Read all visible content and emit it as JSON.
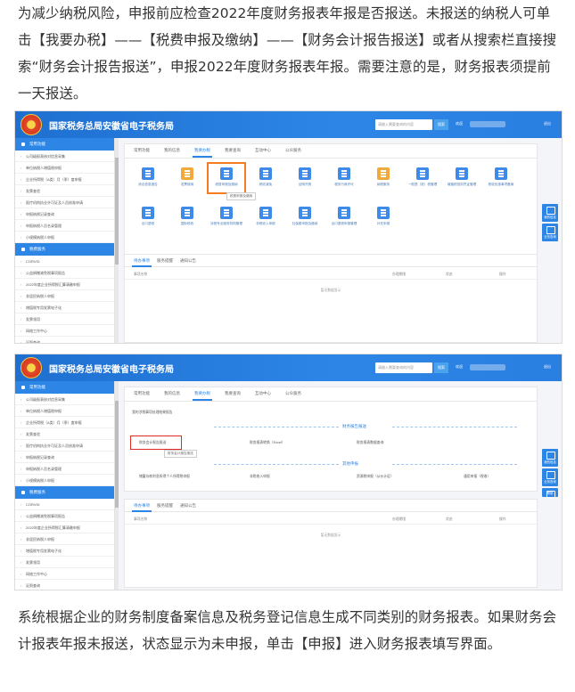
{
  "paragraph_top": "为减少纳税风险，申报前应检查2022年度财务报表年报是否报送。未报送的纳税人可单击【我要办税】——【税费申报及缴纳】——【财务会计报告报送】或者从搜索栏直接搜索“财务会计报告报送”，申报2022年度财务报表年报。需要注意的是，财务报表须提前一天报送。",
  "paragraph_bottom": "系统根据企业的财务制度备案信息及税务登记信息生成不同类别的财务报表。如果财务会计报表年报未报送，状态显示为未申报，单击【申报】进入财务报表填写界面。",
  "site": {
    "title": "国家税务总局安徽省电子税务局",
    "search_placeholder": "请输入需要查询的内容",
    "search_button": "搜索",
    "user_label": "欢迎",
    "logout": "退出"
  },
  "sidebar": {
    "section1": "常用功能",
    "items1": [
      "公司级报表核对信息采集",
      "单位纳税人增值税申报",
      "企业所得税（A类）月（季）度申报",
      "发票查验",
      "医疗机构执业许可证及人员核准申请",
      "申报纳税记录查询",
      "申报纳税人员名录管理",
      "小规模纳税人申报"
    ],
    "section2": "税费服务",
    "items2": [
      "CORVID",
      "公益捐赠减免税事项报告",
      "2022年度企业所得税汇算清缴申报",
      "非居民纳税人申报",
      "增值税专用发票电子化",
      "发票领用",
      "网络工作中心",
      "证照查询"
    ]
  },
  "tabs": [
    "常用功能",
    "我的信息",
    "我要办税",
    "我要查询",
    "互动中心",
    "公众服务"
  ],
  "active_tab_index": 2,
  "icons_row1": [
    "综合信息报告",
    "发票使用",
    "税费申报及缴纳",
    "税收减免",
    "证明开具",
    "税务行政许可",
    "纳税服务",
    "一般退（抵）税管理",
    "增值税抵扣凭证管理",
    "税收优惠事项备案"
  ],
  "icons_row2": [
    "出口退税",
    "国际税收",
    "涉税专业服务机构管理",
    "非税收入申报",
    "社保费申报及缴纳",
    "出口退税申报管理",
    "补充申报"
  ],
  "tooltip": "税费申报及缴纳",
  "lower_tabs": [
    "待办事项",
    "服务提醒",
    "通知公告"
  ],
  "table_headers": [
    "事项名称",
    "办理期限",
    "状态",
    "操作"
  ],
  "empty_text": "暂无数据显示",
  "float_buttons": [
    "我的信息",
    "业务查询",
    "帮助"
  ],
  "breadcrumb": "我的涉税事项处理结果报告",
  "section_financial": "财务报告报送",
  "links_financial": [
    "财务会计报告报送",
    "财务报表转换（Excel）",
    "财务报表数据查询"
  ],
  "tooltip2": "财务会计报告报送",
  "section_other": "其他申报",
  "links_other": [
    "储蓄存款利息所得个人所得税申报",
    "非税收入申报",
    "资源税申报（从价计征）",
    "通用申报（税收）"
  ],
  "colors": {
    "header_blue": "#2d86e6",
    "highlight_orange": "#f57c1f",
    "highlight_red": "#e02a2a"
  }
}
